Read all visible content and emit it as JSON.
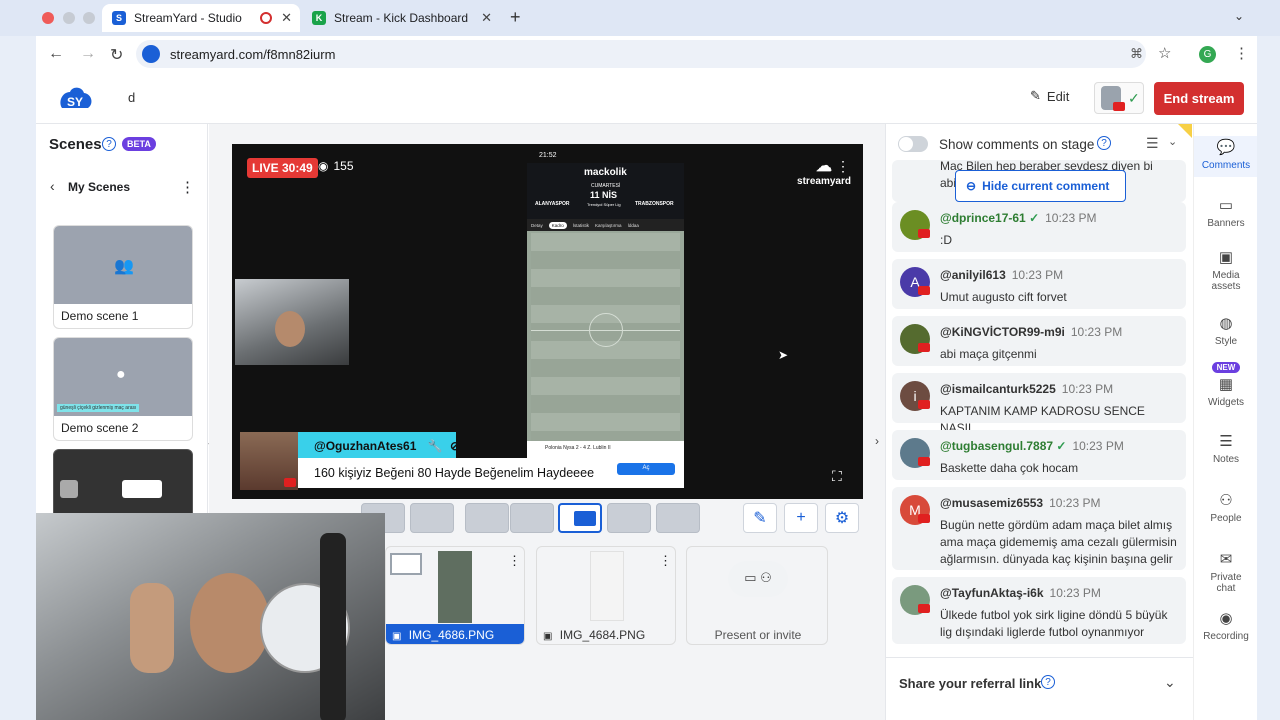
{
  "browser": {
    "tabs": [
      {
        "title": "StreamYard - Studio",
        "favicon": "S"
      },
      {
        "title": "Stream - Kick Dashboard",
        "favicon": "K"
      }
    ],
    "url": "streamyard.com/f8mn82iurm"
  },
  "header": {
    "broadcast_title": "d",
    "edit_label": "Edit",
    "end_stream_label": "End stream"
  },
  "scenes": {
    "title": "Scenes",
    "beta_badge": "BETA",
    "my_scenes_label": "My Scenes",
    "items": [
      {
        "label": "Demo scene 1"
      },
      {
        "label": "Demo scene 2",
        "caption": "güneşli çiçekli gizlenmiş maç arası"
      }
    ]
  },
  "stage": {
    "live_label": "LIVE 30:49",
    "viewers": "155",
    "watermark": "streamyard",
    "banner_name": "@OguzhanAtes61",
    "banner_text": "160 kişiyiz Beğeni 80 Hayde Beğenelim Haydeeee"
  },
  "phone": {
    "time": "21:52",
    "app_name": "mackolik",
    "date_day": "CUMARTESİ",
    "date": "11 NİS",
    "league": "Trendyol Süper Lig",
    "home_team": "ALANYASPOR",
    "away_team": "TRABZONSPOR",
    "tabs": [
      "Detay",
      "Kadro",
      "İstatistik",
      "Karşılaştırma",
      "İddaa"
    ],
    "ad_label": "Aç",
    "footer_text": "Polonia Nysa 2 - 4 Z. Lublin II"
  },
  "media": {
    "items": [
      {
        "label": "IMG_4686.PNG",
        "selected": true
      },
      {
        "label": "IMG_4684.PNG",
        "selected": false
      }
    ],
    "present_label": "Present or invite"
  },
  "comments_panel": {
    "show_on_stage_label": "Show comments on stage",
    "hide_current_label": "Hide current comment",
    "partial_text": "Maç Bilen hep beraber sevdesz diyen bi abi vardı 😀",
    "comments": [
      {
        "user": "@dprince17-61",
        "time": "10:23 PM",
        "text": ":D",
        "color": "#6b8e23",
        "initial": "",
        "verified": true
      },
      {
        "user": "@anilyil613",
        "time": "10:23 PM",
        "text": "Umut augusto cift forvet",
        "color": "#4a3aa8",
        "initial": "A",
        "verified": false
      },
      {
        "user": "@KiNGVİCTOR99-m9i",
        "time": "10:23 PM",
        "text": "abi maça gitçenmi",
        "color": "#556b2f",
        "initial": "",
        "verified": false
      },
      {
        "user": "@ismailcanturk5225",
        "time": "10:23 PM",
        "text": "KAPTANIM KAMP KADROSU SENCE NASIL",
        "color": "#6d4c41",
        "initial": "i",
        "verified": false
      },
      {
        "user": "@tugbasengul.7887",
        "time": "10:23 PM",
        "text": "Baskette daha çok hocam",
        "color": "#5d7a8c",
        "initial": "",
        "verified": true
      },
      {
        "user": "@musasemiz6553",
        "time": "10:23 PM",
        "text": "Bugün nette gördüm adam maça bilet almış ama maça gidememiş ama cezalı gülermisin ağlarmısın. dünyada kaç kişinin başına gelir",
        "color": "#d84a3a",
        "initial": "M",
        "verified": false
      },
      {
        "user": "@TayfunAktaş-i6k",
        "time": "10:23 PM",
        "text": "Ülkede futbol yok sirk ligine döndü 5 büyük lig dışındaki liglerde futbol oynanmıyor",
        "color": "#7a9a7e",
        "initial": "",
        "verified": false
      }
    ],
    "referral_label": "Share your referral link"
  },
  "rail": {
    "items": [
      {
        "label": "Comments",
        "icon": "comment-icon"
      },
      {
        "label": "Banners",
        "icon": "banner-icon"
      },
      {
        "label": "Media assets",
        "icon": "media-icon"
      },
      {
        "label": "Style",
        "icon": "palette-icon"
      },
      {
        "label": "Widgets",
        "icon": "widgets-icon",
        "badge": "NEW"
      },
      {
        "label": "Notes",
        "icon": "notes-icon"
      },
      {
        "label": "People",
        "icon": "people-icon"
      },
      {
        "label": "Private chat",
        "icon": "chat-icon"
      },
      {
        "label": "Recording",
        "icon": "record-icon"
      }
    ]
  },
  "colors": {
    "accent": "#1a5fd6",
    "end_stream": "#d32f2f",
    "live": "#e53935",
    "banner_cyan": "#39d0ea"
  }
}
